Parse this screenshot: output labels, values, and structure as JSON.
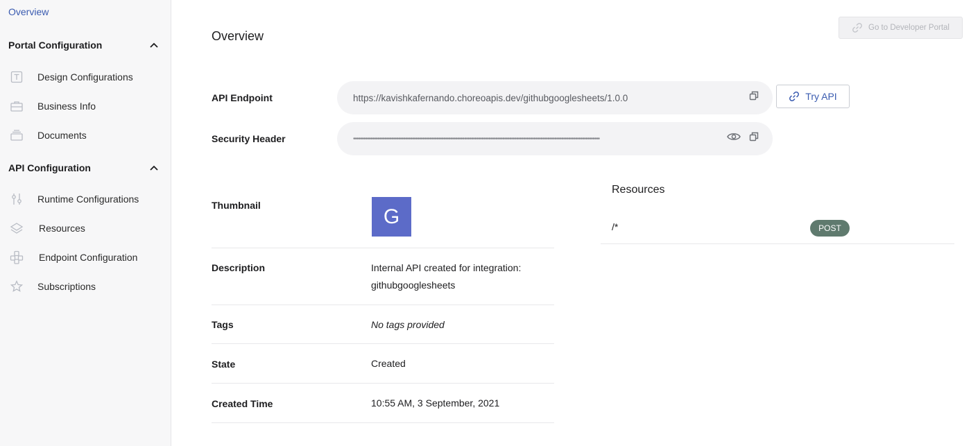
{
  "sidebar": {
    "overview": "Overview",
    "portal_section": "Portal Configuration",
    "portal_items": [
      {
        "label": "Design Configurations",
        "icon": "text-template-icon"
      },
      {
        "label": "Business Info",
        "icon": "briefcase-icon"
      },
      {
        "label": "Documents",
        "icon": "document-stack-icon"
      }
    ],
    "api_section": "API Configuration",
    "api_items": [
      {
        "label": "Runtime Configurations",
        "icon": "sliders-icon"
      },
      {
        "label": "Resources",
        "icon": "layers-icon"
      },
      {
        "label": "Endpoint Configuration",
        "icon": "endpoint-icon"
      },
      {
        "label": "Subscriptions",
        "icon": "star-icon"
      }
    ]
  },
  "header": {
    "title": "Overview",
    "dev_portal_button": "Go to Developer Portal"
  },
  "endpoint": {
    "label": "API Endpoint",
    "url": "https://kavishkafernando.choreoapis.dev/githubgooglesheets/1.0.0",
    "try_button": "Try API"
  },
  "security": {
    "label": "Security Header",
    "masked_value": "••••••••••••••••••••••••••••••••••••••••••••••••••••••••••••••••••••••••••••••••••••••••••••••••••••••••••••••••••••••••••••••••••••••••••••••"
  },
  "details": {
    "thumbnail_label": "Thumbnail",
    "thumbnail_letter": "G",
    "description_label": "Description",
    "description_line1": "Internal API created for integration:",
    "description_line2": "githubgooglesheets",
    "tags_label": "Tags",
    "tags_value": "No tags provided",
    "state_label": "State",
    "state_value": "Created",
    "created_label": "Created Time",
    "created_value": "10:55 AM, 3 September, 2021"
  },
  "resources": {
    "title": "Resources",
    "items": [
      {
        "path": "/*",
        "method": "POST"
      }
    ]
  },
  "colors": {
    "accent": "#3a5bb0",
    "thumbnail_bg": "#5c6bc8",
    "post_badge": "#5f7a6e"
  }
}
